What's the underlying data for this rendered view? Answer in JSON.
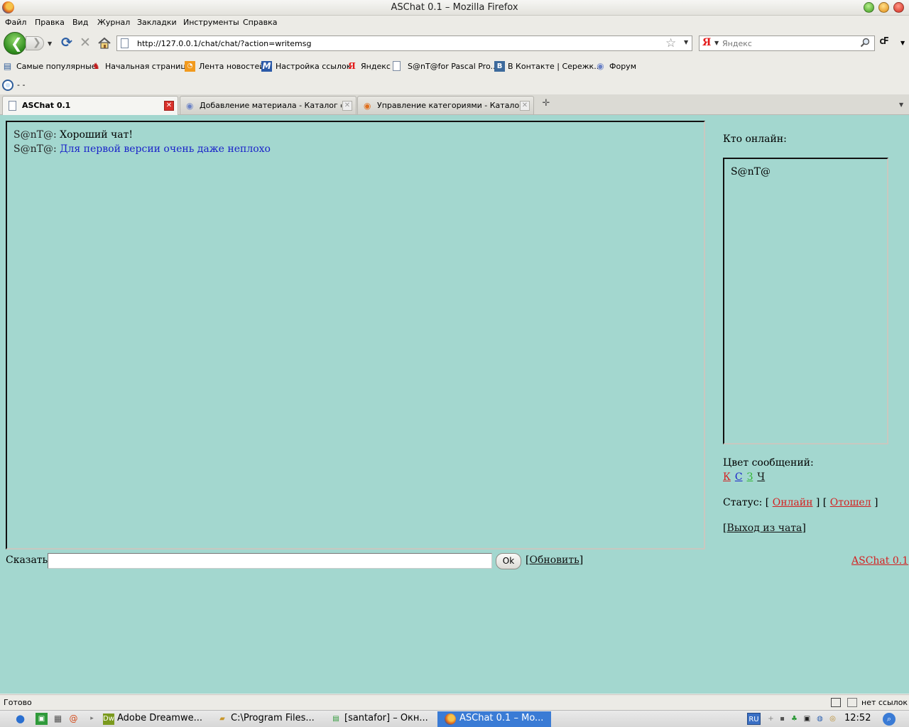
{
  "window": {
    "title": "ASChat 0.1 – Mozilla Firefox"
  },
  "menu": [
    "Файл",
    "Правка",
    "Вид",
    "Журнал",
    "Закладки",
    "Инструменты",
    "Справка"
  ],
  "navbar": {
    "url": "http://127.0.0.1/chat/chat/?action=writemsg",
    "search_engine_glyph": "Я",
    "search_placeholder": "Яндекс",
    "addon_label": "cF"
  },
  "bookmarks": [
    {
      "label": "Самые популярные",
      "icon": "bookmark-folder-icon"
    },
    {
      "label": "Начальная страница",
      "icon": "red-bird-icon"
    },
    {
      "label": "Лента новостей",
      "icon": "rss-feed-icon"
    },
    {
      "label": "Настройка ссылок",
      "icon": "m-logo-icon"
    },
    {
      "label": "Яндекс",
      "icon": "yandex-icon"
    },
    {
      "label": "S@nT@for Pascal Pro...",
      "icon": "page-icon"
    },
    {
      "label": "В Контакте | Сережк...",
      "icon": "vkontakte-icon"
    },
    {
      "label": "Форум",
      "icon": "forum-icon"
    }
  ],
  "extra_toolbar": {
    "label": "- -"
  },
  "tabs": [
    {
      "label": "ASChat 0.1",
      "active": true
    },
    {
      "label": "Добавление материала - Каталог фа...",
      "active": false
    },
    {
      "label": "Управление категориями - Каталог ...",
      "active": false
    }
  ],
  "chat": {
    "messages": [
      {
        "nick": "S@nT@:",
        "text": "Хороший чат!",
        "color": "#222222"
      },
      {
        "nick": "S@nT@:",
        "text": "Для первой версии очень даже неплохо",
        "color": "#1a23c9"
      }
    ],
    "say_label": "Сказать:",
    "say_value": "",
    "ok_label": "Ok",
    "refresh_open": "[",
    "refresh_label": "Обновить",
    "refresh_close": "]",
    "footer_link": "ASChat 0.1"
  },
  "sidebar": {
    "online_title": "Кто онлайн:",
    "online_users": [
      "S@nT@"
    ],
    "color_title": "Цвет сообщений:",
    "colors": [
      {
        "label": "К",
        "color": "#d42020"
      },
      {
        "label": "С",
        "color": "#1a23c9"
      },
      {
        "label": "З",
        "color": "#2fb52f"
      },
      {
        "label": "Ч",
        "color": "#111111"
      }
    ],
    "status_prefix": "Статус: [",
    "status_online": "Онлайн",
    "status_mid": "] [",
    "status_away": "Отошел",
    "status_suffix": "]",
    "exit_open": "[",
    "exit_label": "Выход из чата",
    "exit_close": "]"
  },
  "statusbar": {
    "text": "Готово",
    "links": "нет ссылок"
  },
  "taskbar": {
    "tasks": [
      {
        "label": "Adobe Dreamwe...",
        "icon": "dreamweaver-icon",
        "active": false
      },
      {
        "label": "C:\\Program Files...",
        "icon": "folder-icon",
        "active": false
      },
      {
        "label": "[santafor] – Окн...",
        "icon": "chat-window-icon",
        "active": false
      },
      {
        "label": "ASChat 0.1 – Mo...",
        "icon": "firefox-icon",
        "active": true
      }
    ],
    "lang": "RU",
    "clock": "12:52"
  }
}
